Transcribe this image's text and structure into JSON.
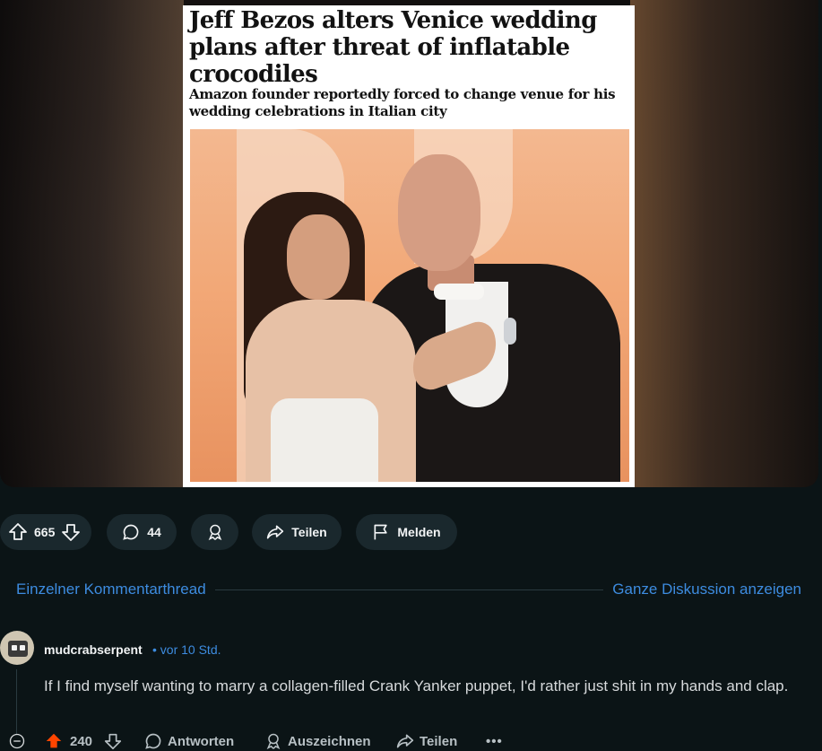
{
  "article": {
    "headline": "Jeff Bezos alters Venice wedding plans after threat of inflatable crocodiles",
    "standfirst": "Amazon founder reportedly forced to change venue for his wedding celebrations in Italian city"
  },
  "actions": {
    "score": "665",
    "comments": "44",
    "share_label": "Teilen",
    "report_label": "Melden"
  },
  "thread": {
    "single_thread_label": "Einzelner Kommentarthread",
    "full_discussion_label": "Ganze Diskussion anzeigen"
  },
  "comment": {
    "username": "mudcrabserpent",
    "time": "• vor 10 Std.",
    "body": "If I find myself wanting to marry a collagen-filled Crank Yanker puppet, I'd rather just shit in my hands and clap.",
    "score": "240",
    "reply_label": "Antworten",
    "award_label": "Auszeichnen",
    "share_label": "Teilen",
    "more_label": "•••"
  },
  "colors": {
    "background": "#0b1416",
    "pill": "#1a282d",
    "link": "#3d8ce0",
    "upvoted": "#ff4500"
  }
}
